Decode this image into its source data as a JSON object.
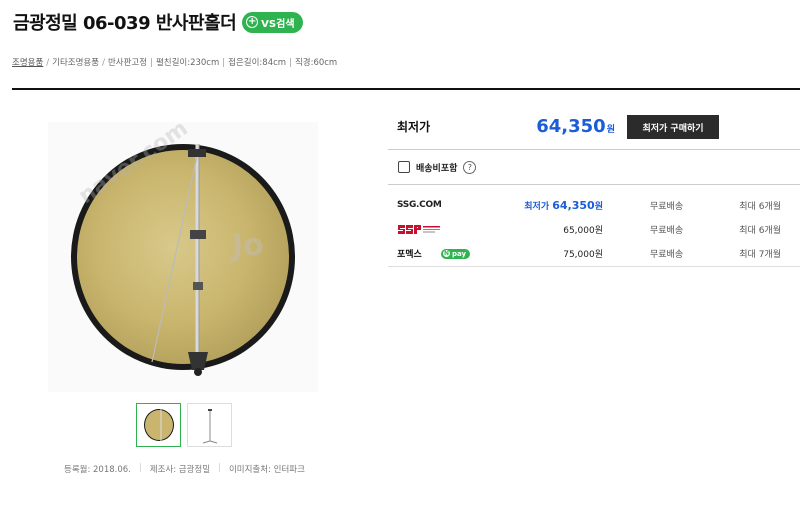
{
  "product": {
    "title": "금광정밀 06-039 반사판홀더",
    "vs_badge": "VS검색"
  },
  "breadcrumb": {
    "items": [
      "조명용품",
      "기타조명용품",
      "반사판고정",
      "펼친길이:230cm",
      "접은길이:84cm",
      "직경:60cm"
    ]
  },
  "watermark": {
    "text1": "naver.com",
    "text2": "Jo"
  },
  "meta": {
    "registered": "등록월: 2018.06.",
    "maker": "제조사: 금광정밀",
    "image_source": "이미지출처: 인터파크"
  },
  "pricing": {
    "lowest_label": "최저가",
    "lowest_price": "64,350",
    "currency": "원",
    "buy_button": "최저가 구매하기",
    "shipping_checkbox_label": "배송비포함",
    "help": "?"
  },
  "sellers": [
    {
      "logo": "SSG.COM",
      "price_prefix": "최저가",
      "price": "64,350",
      "won": "원",
      "shipping": "무료배송",
      "installment": "최대 6개월"
    },
    {
      "logo": "SSG SHOPPING MALL",
      "price": "65,000원",
      "shipping": "무료배송",
      "installment": "최대 6개월"
    },
    {
      "logo": "포멕스",
      "npay": "pay",
      "npay_n": "N",
      "price": "75,000원",
      "shipping": "무료배송",
      "installment": "최대 7개월"
    }
  ],
  "colors": {
    "accent_green": "#2fb350",
    "price_blue": "#1a5dd6",
    "button_dark": "#2b2b2b"
  }
}
